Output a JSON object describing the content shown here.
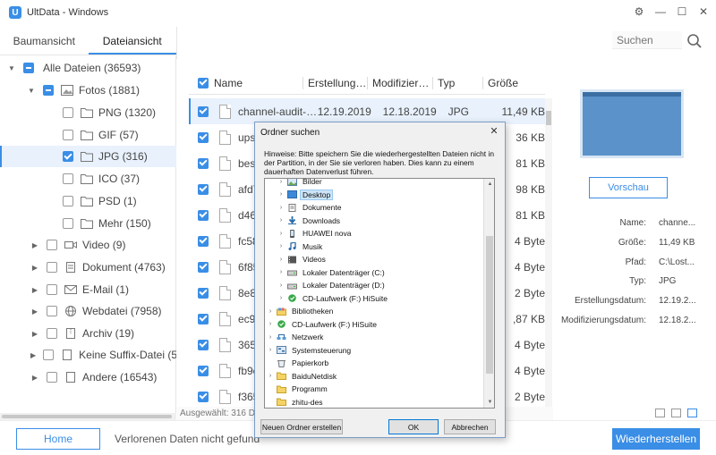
{
  "app": {
    "title": "UltData - Windows",
    "logo_letter": "U"
  },
  "window_controls": {
    "settings": "⚙",
    "minimize": "—",
    "maximize": "☐",
    "close": "✕"
  },
  "tabs": [
    {
      "label": "Baumansicht"
    },
    {
      "label": "Dateiansicht"
    }
  ],
  "search": {
    "placeholder": "Suchen"
  },
  "tree": [
    {
      "label": "Alle Dateien (36593)",
      "arrow": "▼",
      "check": "partial",
      "icon": "folder-icon"
    },
    {
      "label": "Fotos (1881)",
      "arrow": "▼",
      "check": "partial",
      "icon": "image-icon"
    },
    {
      "label": "PNG (1320)",
      "arrow": "",
      "check": "off",
      "icon": "folder-icon"
    },
    {
      "label": "GIF (57)",
      "arrow": "",
      "check": "off",
      "icon": "folder-icon"
    },
    {
      "label": "JPG (316)",
      "arrow": "",
      "check": "on",
      "icon": "folder-icon"
    },
    {
      "label": "ICO (37)",
      "arrow": "",
      "check": "off",
      "icon": "folder-icon"
    },
    {
      "label": "PSD (1)",
      "arrow": "",
      "check": "off",
      "icon": "folder-icon"
    },
    {
      "label": "Mehr (150)",
      "arrow": "",
      "check": "off",
      "icon": "folder-icon"
    },
    {
      "label": "Video (9)",
      "arrow": "▶",
      "check": "off",
      "icon": "video-icon"
    },
    {
      "label": "Dokument (4763)",
      "arrow": "▶",
      "check": "off",
      "icon": "document-icon"
    },
    {
      "label": "E-Mail (1)",
      "arrow": "▶",
      "check": "off",
      "icon": "mail-icon"
    },
    {
      "label": "Webdatei (7958)",
      "arrow": "▶",
      "check": "off",
      "icon": "globe-icon"
    },
    {
      "label": "Archiv (19)",
      "arrow": "▶",
      "check": "off",
      "icon": "archive-icon"
    },
    {
      "label": "Keine Suffix-Datei (541",
      "arrow": "▶",
      "check": "off",
      "icon": "file-icon"
    },
    {
      "label": "Andere (16543)",
      "arrow": "▶",
      "check": "off",
      "icon": "file-icon"
    }
  ],
  "list": {
    "columns": [
      "Name",
      "Erstellungs...",
      "Modifizierung...",
      "Typ",
      "Größe"
    ],
    "rows": [
      {
        "name": "channel-audit-t...",
        "created": "12.19.2019",
        "modified": "12.18.2019",
        "type": "JPG",
        "size": "11,49 KB"
      },
      {
        "name": "upse",
        "created": "",
        "modified": "",
        "type": "",
        "size": "36 KB"
      },
      {
        "name": "best-",
        "created": "",
        "modified": "",
        "type": "",
        "size": "81 KB"
      },
      {
        "name": "afd7",
        "created": "",
        "modified": "",
        "type": "",
        "size": "98 KB"
      },
      {
        "name": "d463",
        "created": "",
        "modified": "",
        "type": "",
        "size": "81 KB"
      },
      {
        "name": "fc58",
        "created": "",
        "modified": "",
        "type": "",
        "size": "4 Byte"
      },
      {
        "name": "6f85",
        "created": "",
        "modified": "",
        "type": "",
        "size": "4 Byte"
      },
      {
        "name": "8e8a",
        "created": "",
        "modified": "",
        "type": "",
        "size": "2 Byte"
      },
      {
        "name": "ec9e",
        "created": "",
        "modified": "",
        "type": "",
        "size": ",87 KB"
      },
      {
        "name": "365a",
        "created": "",
        "modified": "",
        "type": "",
        "size": "4 Byte"
      },
      {
        "name": "fb9c",
        "created": "",
        "modified": "",
        "type": "",
        "size": "4 Byte"
      },
      {
        "name": "f365",
        "created": "",
        "modified": "",
        "type": "",
        "size": "2 Byte"
      }
    ],
    "status": "Ausgewählt: 316 Da"
  },
  "preview": {
    "button": "Vorschau",
    "meta": [
      {
        "label": "Name:",
        "value": "channe..."
      },
      {
        "label": "Größe:",
        "value": "11,49 KB"
      },
      {
        "label": "Pfad:",
        "value": "C:\\Lost..."
      },
      {
        "label": "Typ:",
        "value": "JPG"
      },
      {
        "label": "Erstellungsdatum:",
        "value": "12.19.2..."
      },
      {
        "label": "Modifizierungsdatum:",
        "value": "12.18.2..."
      }
    ]
  },
  "footer": {
    "home_button": "Home",
    "text": "Verlorenen Daten nicht gefund",
    "restore_button": "Wiederherstellen"
  },
  "dialog": {
    "title": "Ordner suchen",
    "close": "✕",
    "hint": "Hinweise: Bitte speichern Sie die wiederhergestellten Dateien nicht in der Partition, in der Sie sie verloren haben. Dies kann zu einem dauerhaften Datenverlust führen.",
    "tree": [
      {
        "label": "Bilder",
        "chev": "›",
        "indent": 1,
        "icon": "pictures-icon"
      },
      {
        "label": "Desktop",
        "chev": "›",
        "indent": 1,
        "icon": "desktop-icon",
        "selected": true
      },
      {
        "label": "Dokumente",
        "chev": "›",
        "indent": 1,
        "icon": "documents-icon"
      },
      {
        "label": "Downloads",
        "chev": "›",
        "indent": 1,
        "icon": "downloads-icon"
      },
      {
        "label": "HUAWEI nova",
        "chev": "›",
        "indent": 1,
        "icon": "phone-icon"
      },
      {
        "label": "Musik",
        "chev": "›",
        "indent": 1,
        "icon": "music-icon"
      },
      {
        "label": "Videos",
        "chev": "›",
        "indent": 1,
        "icon": "videos-icon"
      },
      {
        "label": "Lokaler Datenträger (C:)",
        "chev": "›",
        "indent": 1,
        "icon": "drive-icon"
      },
      {
        "label": "Lokaler Datenträger (D:)",
        "chev": "›",
        "indent": 1,
        "icon": "drive-icon"
      },
      {
        "label": "CD-Laufwerk (F:) HiSuite",
        "chev": "›",
        "indent": 1,
        "icon": "cd-icon"
      },
      {
        "label": "Bibliotheken",
        "chev": "›",
        "indent": 0,
        "icon": "libraries-icon"
      },
      {
        "label": "CD-Laufwerk (F:) HiSuite",
        "chev": "›",
        "indent": 0,
        "icon": "cd-icon"
      },
      {
        "label": "Netzwerk",
        "chev": "›",
        "indent": 0,
        "icon": "network-icon"
      },
      {
        "label": "Systemsteuerung",
        "chev": "›",
        "indent": 0,
        "icon": "control-panel-icon"
      },
      {
        "label": "Papierkorb",
        "chev": "",
        "indent": 0,
        "icon": "recycle-bin-icon"
      },
      {
        "label": "BaiduNetdisk",
        "chev": "›",
        "indent": 0,
        "icon": "folder-icon"
      },
      {
        "label": "Programm",
        "chev": "",
        "indent": 0,
        "icon": "folder-icon"
      },
      {
        "label": "zhitu-des",
        "chev": "",
        "indent": 0,
        "icon": "folder-icon"
      }
    ],
    "new_folder_button": "Neuen Ordner erstellen",
    "ok_button": "OK",
    "cancel_button": "Abbrechen"
  },
  "colors": {
    "accent": "#3a8ee6",
    "selected_bg": "#e8f1fc",
    "dialog_bg": "#f0f0f0"
  }
}
